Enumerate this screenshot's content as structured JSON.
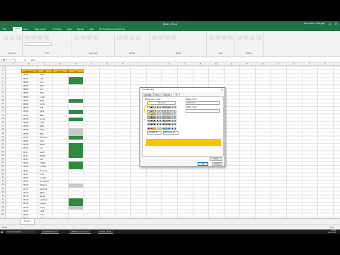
{
  "window": {
    "title": "Book1 - Excel",
    "user": "สอนทำเอกสาร โดยครูเอก",
    "controls": "— ☐ ✕"
  },
  "menu": {
    "items": [
      "File",
      "Home",
      "Insert",
      "Page Layout",
      "Formulas",
      "Data",
      "Review",
      "View",
      "Tell me what you want to do"
    ],
    "active": "Home"
  },
  "ribbon": {
    "groups": [
      "Clipboard",
      "Font",
      "Alignment",
      "Number",
      "Styles",
      "Cells",
      "Editing"
    ]
  },
  "formula_bar": {
    "name_box": "E5",
    "fx": "fx",
    "value": "ผ่าน"
  },
  "sheet": {
    "columns": [
      "A",
      "B",
      "C",
      "D",
      "E",
      "F",
      "G",
      "H",
      "I",
      "J",
      "K",
      "L",
      "M",
      "N",
      "O",
      "P",
      "Q",
      "R",
      "S",
      "T",
      "U"
    ],
    "rows": [
      "1",
      "2",
      "3",
      "4",
      "5",
      "6",
      "7",
      "8",
      "9",
      "10",
      "11",
      "12",
      "13",
      "14",
      "15",
      "16",
      "17",
      "18",
      "19",
      "20",
      "21",
      "22",
      "23",
      "24",
      "25",
      "26",
      "27",
      "28",
      "29",
      "30",
      "31",
      "32",
      "33",
      "34",
      "35",
      "36",
      "37",
      "38",
      "39",
      "40",
      "41"
    ],
    "headers": [
      "รหัสนักเรียน",
      "ชื่อ",
      "คะแนน",
      "เกรด"
    ],
    "ids": [
      "33690",
      "33691",
      "33692",
      "33693",
      "33694",
      "33695",
      "33696",
      "33697",
      "33698",
      "33699",
      "33700",
      "33701",
      "33702",
      "33703",
      "33704",
      "33705",
      "33706",
      "33707",
      "33708",
      "33709",
      "33710",
      "33711",
      "33712",
      "33713",
      "33714",
      "33715",
      "33716",
      "33717",
      "33718",
      "33719",
      "33720",
      "33721",
      "33722",
      "33723",
      "33724",
      "33725",
      "33726",
      "33727",
      "33728",
      "33729"
    ],
    "names": [
      "มนตรา",
      "ชนที",
      "เมษา",
      "สุพัตรา",
      "ณวย",
      "ปรีชา",
      "วรวุฒิ",
      "สุรชัย",
      "พรรณี",
      "นิยดี",
      "กุลวดี",
      "ศศิธร",
      "สุภาพร",
      "มาลัย",
      "อภิชัย",
      "ปวีณา",
      "ศิริพร",
      "วิไลวรรณ",
      "จันทร์",
      "ณัฐพล",
      "ธนา",
      "พงศกร",
      "ศักดิ์ชัย",
      "รัชนี",
      "ธีรศักดิ์",
      "อารีรัตน์",
      "อุไรวรรณ",
      "ชาตรี",
      "สายสุนีย์",
      "เสาวลักษณ์",
      "กิตติพงษ์",
      "สมเกียรติ",
      "สุพิชชา",
      "ณัฐวุฒิ",
      "นวลจันทร์",
      "ชมพูนุท",
      "สายฝน",
      "ทองดี",
      "อารยา",
      "ประภา"
    ],
    "green_rows": [
      1,
      2,
      7,
      10,
      12,
      17,
      19,
      20,
      21,
      22,
      24,
      25,
      34,
      35
    ],
    "selected_rows": [
      15,
      16,
      21,
      30,
      36
    ]
  },
  "sheet_tab": "Sheet1",
  "status": {
    "left": "Ready",
    "right": "100%"
  },
  "taskbar": {
    "search": "Ask me anything",
    "apps": [
      "ตัว ฟังก์ชันตัวอย่าง",
      "[NEW] สอนทำเอกสาร",
      "Book1 - Excel"
    ],
    "time": "18:49",
    "date": "22/7/2562"
  },
  "dialog": {
    "title": "Format Cells",
    "close": "✕",
    "tabs": [
      "Number",
      "Font",
      "Border",
      "Fill"
    ],
    "active_tab": "Fill",
    "bg_label": "Background Color:",
    "no_color": "No Color",
    "pattern_color_label": "Pattern Color:",
    "pattern_color_value": "Automatic",
    "pattern_style_label": "Pattern Style:",
    "fill_effects": "Fill Effects...",
    "more_colors": "More Colors...",
    "sample_label": "Sample",
    "sample_color": "#ffc000",
    "clear": "Clear",
    "ok": "OK",
    "cancel": "Cancel",
    "palette": [
      [
        "#ffffff",
        "#000000",
        "#eeece1",
        "#1f497d",
        "#4f81bd",
        "#c0504d",
        "#9bbb59",
        "#8064a2",
        "#4bacc6",
        "#f79646"
      ],
      [
        "#f2f2f2",
        "#7f7f7f",
        "#ddd9c3",
        "#c6d9f0",
        "#dbe5f1",
        "#f2dcdb",
        "#ebf1dd",
        "#e5e0ec",
        "#dbeef3",
        "#fdeada"
      ],
      [
        "#d8d8d8",
        "#595959",
        "#c4bd97",
        "#8db3e2",
        "#b8cce4",
        "#e5b9b7",
        "#d7e3bc",
        "#ccc1d9",
        "#b7dde8",
        "#fbd5b5"
      ],
      [
        "#bfbfbf",
        "#3f3f3f",
        "#938953",
        "#548dd4",
        "#95b3d7",
        "#d99694",
        "#c3d69b",
        "#b2a2c7",
        "#92cddc",
        "#fac08f"
      ],
      [
        "#a5a5a5",
        "#262626",
        "#494429",
        "#17365d",
        "#366092",
        "#953734",
        "#76923c",
        "#5f497a",
        "#31859b",
        "#e36c09"
      ],
      [
        "#7f7f7f",
        "#0c0c0c",
        "#1d1b10",
        "#0f243e",
        "#244061",
        "#632423",
        "#4f6128",
        "#3f3151",
        "#205867",
        "#974806"
      ],
      [
        "#c00000",
        "#ff0000",
        "#ffc000",
        "#ffff00",
        "#92d050",
        "#00b050",
        "#00b0f0",
        "#0070c0",
        "#002060",
        "#7030a0"
      ]
    ],
    "highlight_ring": "#f1c40f"
  },
  "colors": {
    "excel_green": "#217346",
    "grade_green": "#2e8b3e",
    "header_gold": "#f4b400"
  }
}
